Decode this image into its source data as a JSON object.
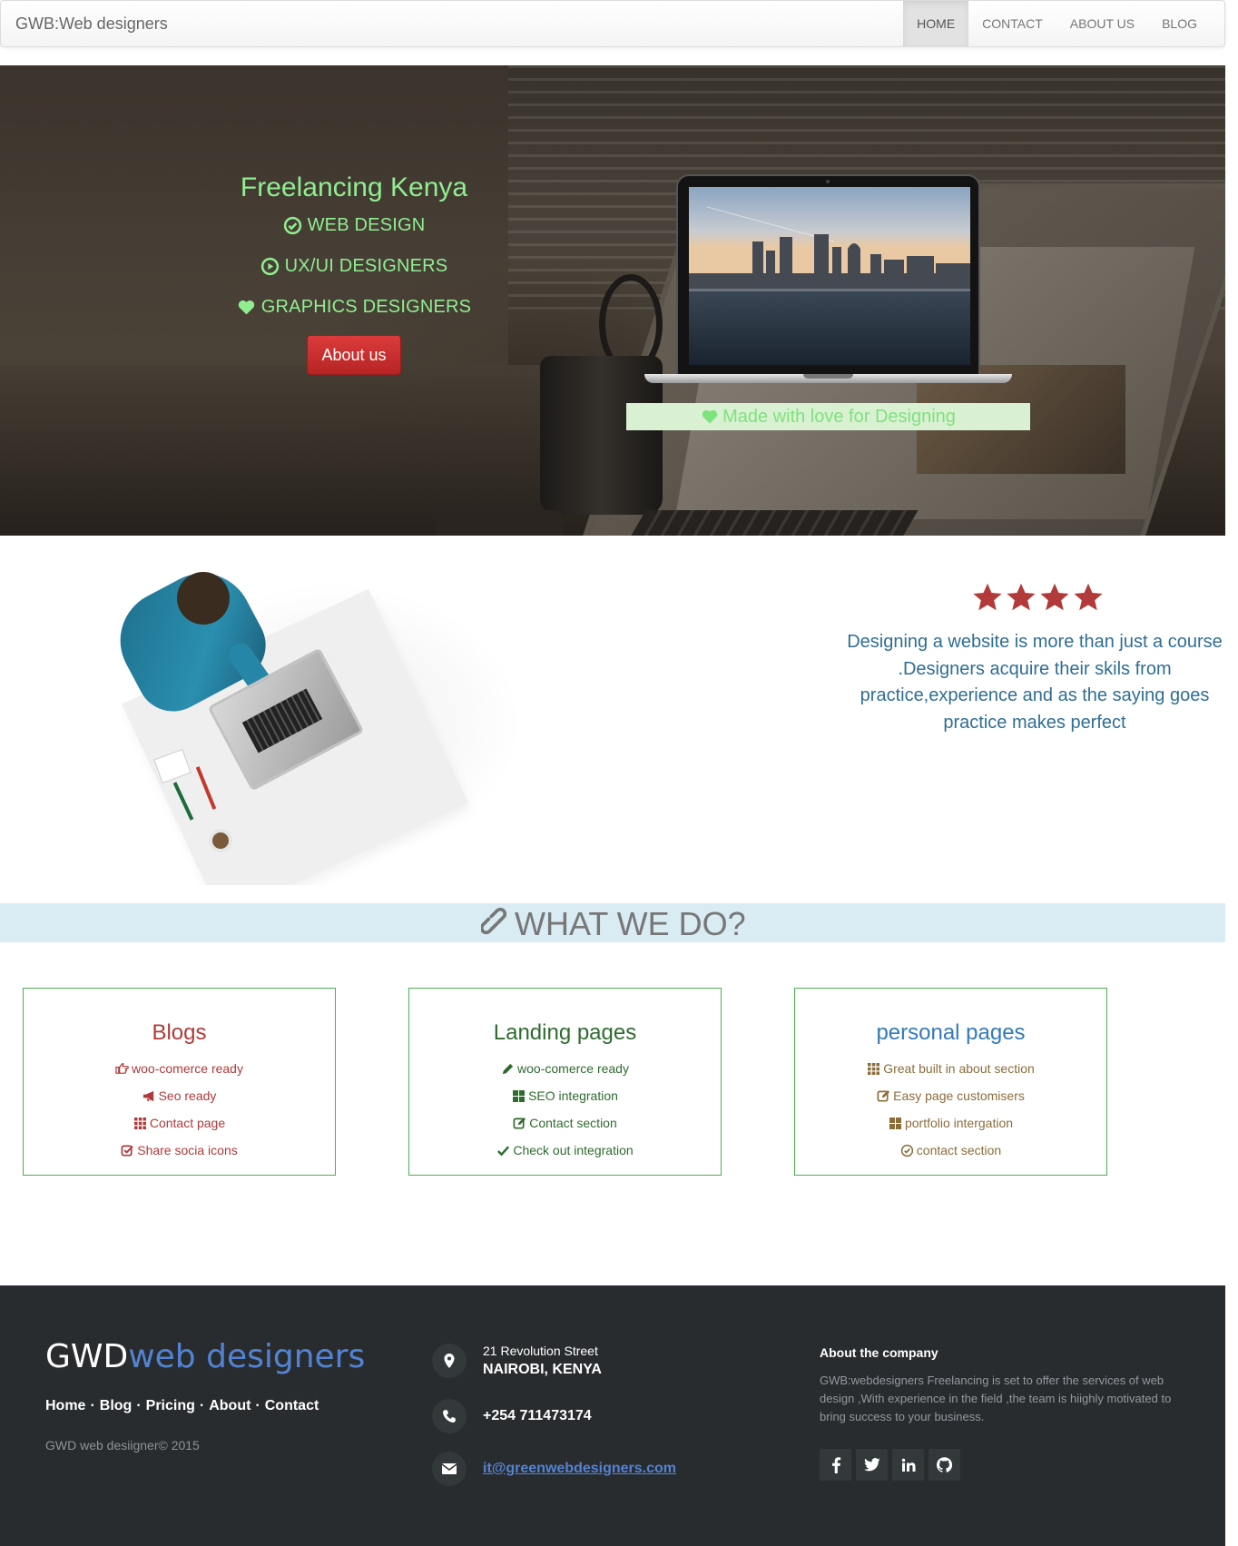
{
  "navbar": {
    "brand": "GWB:Web designers",
    "items": [
      "HOME",
      "CONTACT",
      "ABOUT US",
      "BLOG"
    ],
    "active": "HOME"
  },
  "hero": {
    "title": "Freelancing Kenya",
    "lines": [
      {
        "icon": "check-circle-icon",
        "text": "WEB DESIGN"
      },
      {
        "icon": "play-circle-icon",
        "text": "UX/UI DESIGNERS"
      },
      {
        "icon": "heart-icon",
        "text": "GRAPHICS DESIGNERS"
      }
    ],
    "button": "About us",
    "made_with_love": "Made with love for Designing",
    "text_color": "#90ee90",
    "button_color": "#c9302c"
  },
  "testimonial": {
    "stars": 4,
    "star_color": "#b23a3a",
    "quote": "Designing a website is more than just a course .Designers acquire their skils from practice,experience and as the saying goes practice makes perfect"
  },
  "what_we_do": {
    "title": "WHAT WE DO?",
    "icon": "link-icon",
    "cards": [
      {
        "title": "Blogs",
        "color": "#b03a3a",
        "items": [
          {
            "icon": "hand-right-icon",
            "text": "woo-comerce ready"
          },
          {
            "icon": "bullhorn-icon",
            "text": "Seo ready"
          },
          {
            "icon": "grid-icon",
            "text": "Contact page"
          },
          {
            "icon": "check-square-icon",
            "text": "Share socia icons"
          }
        ]
      },
      {
        "title": "Landing pages",
        "color": "#2f6b2f",
        "items": [
          {
            "icon": "pencil-icon",
            "text": "woo-comerce ready"
          },
          {
            "icon": "grid-large-icon",
            "text": "SEO integration"
          },
          {
            "icon": "edit-icon",
            "text": "Contact section"
          },
          {
            "icon": "checkmark-icon",
            "text": "Check out integration"
          }
        ]
      },
      {
        "title": "personal pages",
        "color": "#337ab7",
        "item_color": "#8a6d3b",
        "items": [
          {
            "icon": "grid-icon",
            "text": "Great built in about section"
          },
          {
            "icon": "edit-icon",
            "text": "Easy page customisers"
          },
          {
            "icon": "grid-large-icon",
            "text": "portfolio intergation"
          },
          {
            "icon": "check-circle-icon",
            "text": "contact section"
          }
        ]
      }
    ]
  },
  "footer": {
    "logo_part1": "GWD",
    "logo_part2": "web designers",
    "links": [
      "Home",
      "Blog",
      "Pricing",
      "About",
      "Contact"
    ],
    "copyright": "GWD web desiigner© 2015",
    "address_line1": "21 Revolution Street",
    "address_line2": "NAIROBI, KENYA",
    "phone": "+254 711473174",
    "email": "it@greenwebdesigners.com",
    "about_title": "About the company",
    "about_text": "GWB:webdesigners Freelancing is set to offer the services of web design ,With experience in the field ,the team is hiighly motivated to bring success to your business.",
    "social": [
      "facebook-icon",
      "twitter-icon",
      "linkedin-icon",
      "github-icon"
    ]
  }
}
